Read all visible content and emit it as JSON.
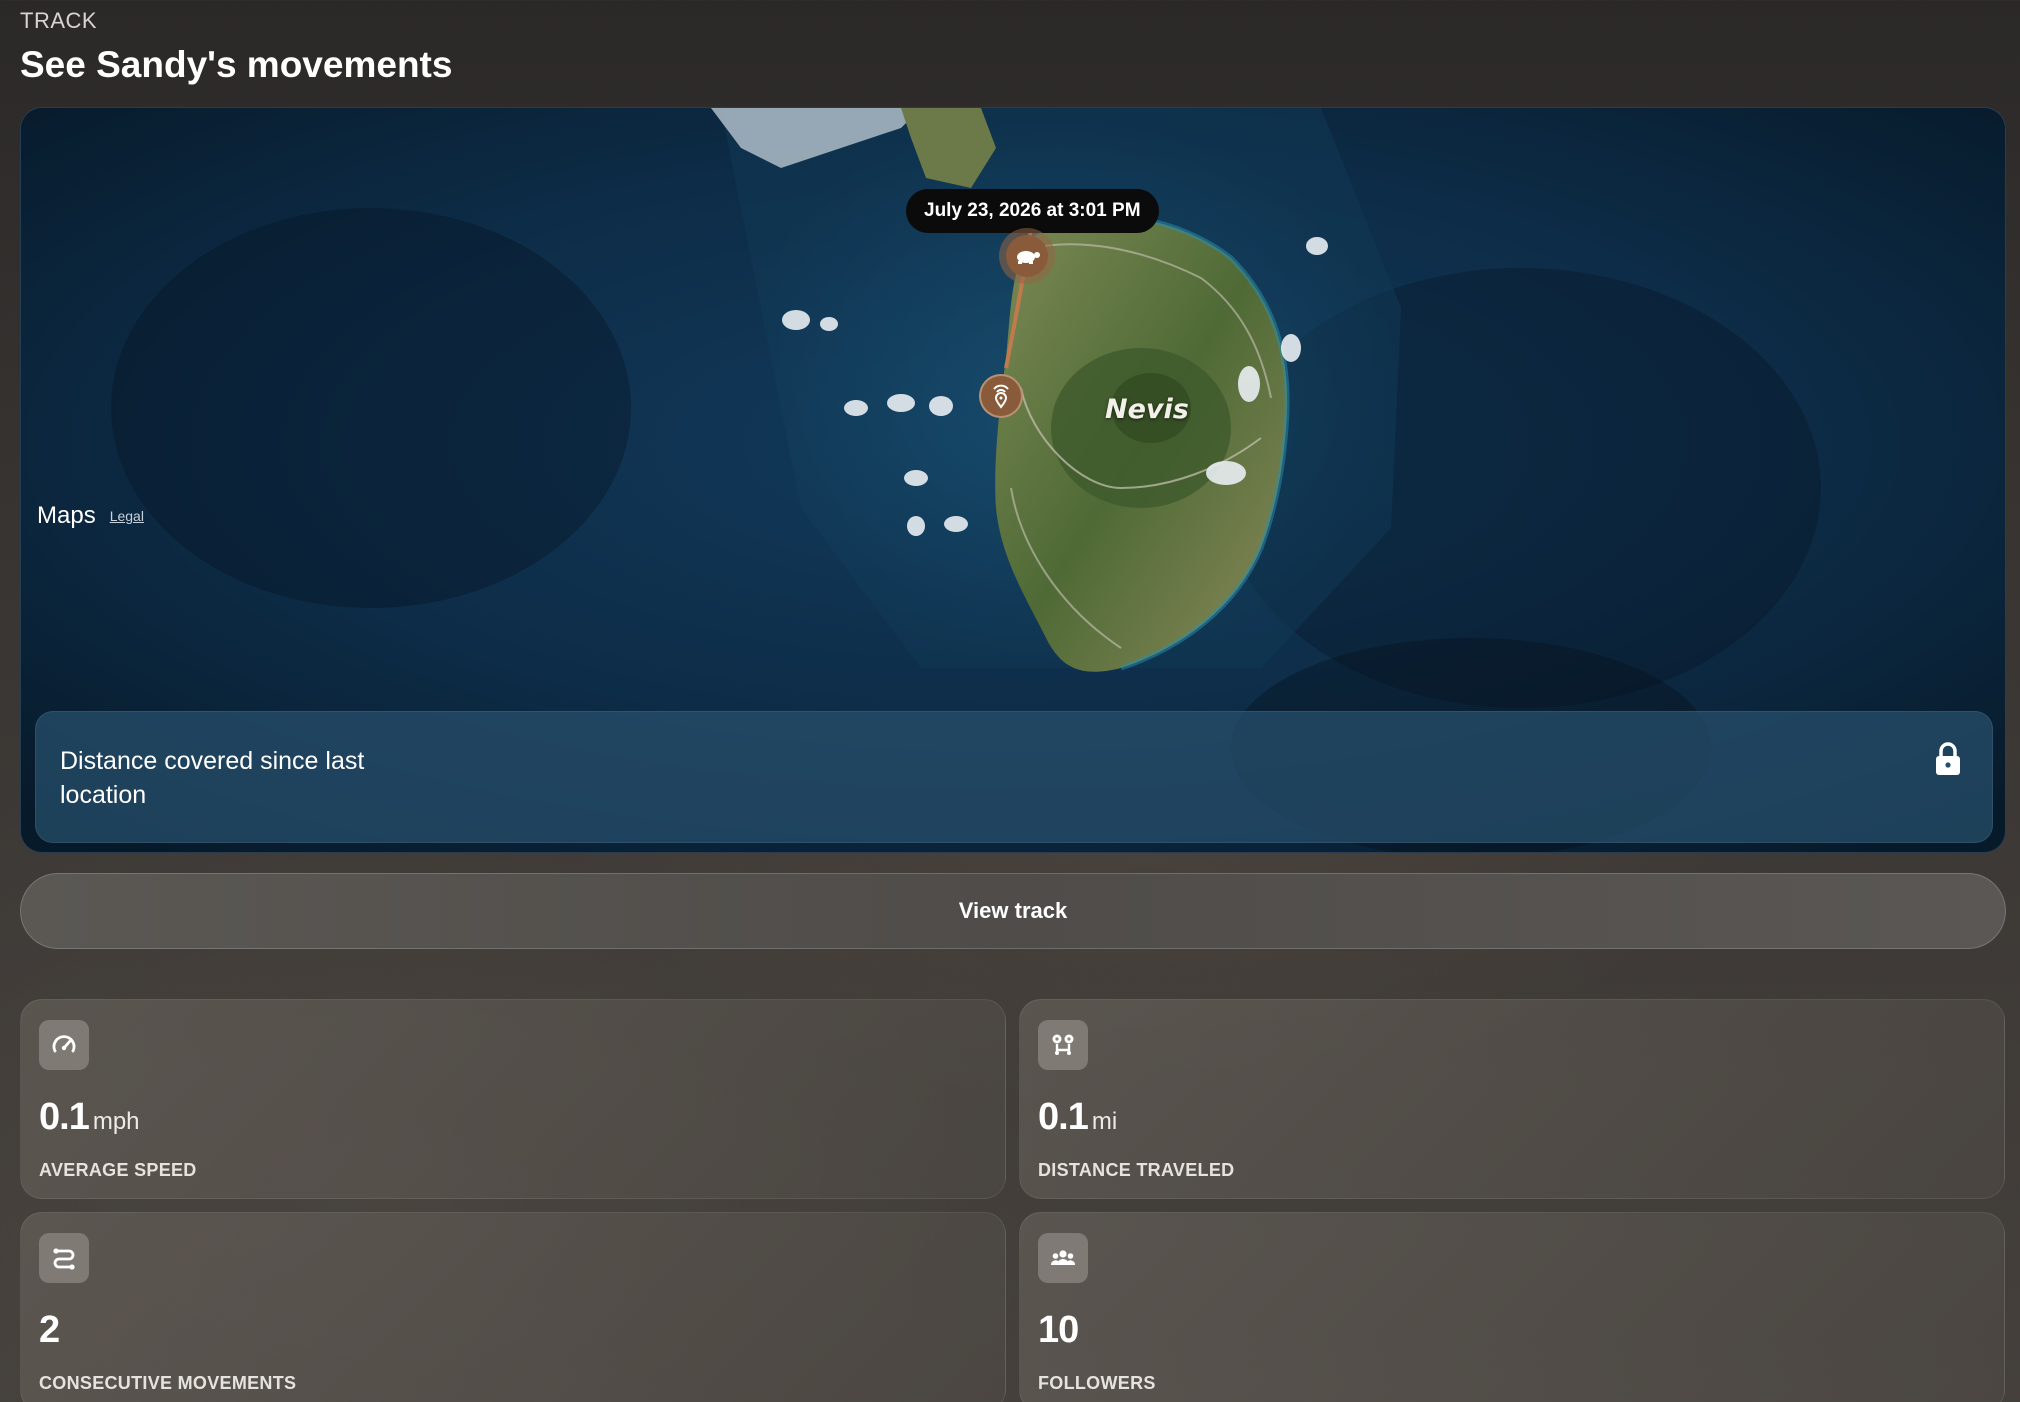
{
  "header": {
    "eyebrow": "TRACK",
    "title": "See Sandy's movements"
  },
  "map": {
    "brand": "Maps",
    "legal_link": "Legal",
    "island_label": "Nevis",
    "tooltip": "July 23, 2026 at 3:01 PM",
    "markers": [
      "turtle-icon",
      "location-tag-icon"
    ],
    "distance_label": "Distance covered since last location",
    "distance_locked_icon": "lock-icon"
  },
  "actions": {
    "view_track": "View track"
  },
  "stats": [
    {
      "icon": "speedometer-icon",
      "value": "0.1",
      "unit": "mph",
      "label": "AVERAGE SPEED"
    },
    {
      "icon": "distance-pins-icon",
      "value": "0.1",
      "unit": "mi",
      "label": "DISTANCE TRAVELED"
    },
    {
      "icon": "route-icon",
      "value": "2",
      "unit": "",
      "label": "CONSECUTIVE MOVEMENTS"
    },
    {
      "icon": "group-icon",
      "value": "10",
      "unit": "",
      "label": "FOLLOWERS"
    }
  ],
  "colors": {
    "marker": "#8a5b3a",
    "ocean": "#0b2338",
    "land": "#5f6e3b"
  }
}
